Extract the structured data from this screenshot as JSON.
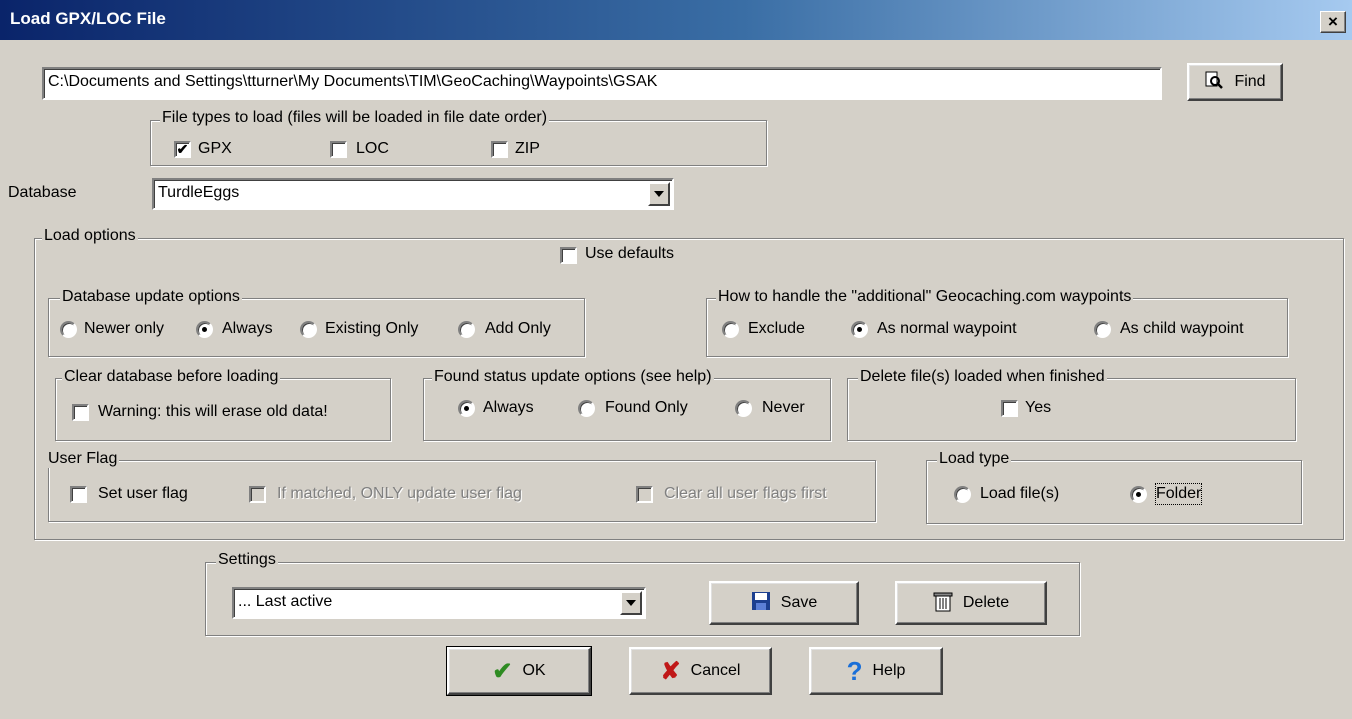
{
  "window": {
    "title": "Load GPX/LOC File",
    "close_glyph": "×"
  },
  "path_field": {
    "value": "C:\\Documents and Settings\\tturner\\My Documents\\TIM\\GeoCaching\\Waypoints\\GSAK"
  },
  "find_button": {
    "label": "Find",
    "icon": "find-document-icon"
  },
  "file_types": {
    "legend": "File types to load (files will be loaded in file date order)",
    "options": [
      {
        "label": "GPX",
        "checked": true
      },
      {
        "label": "LOC",
        "checked": false
      },
      {
        "label": "ZIP",
        "checked": false
      }
    ]
  },
  "database": {
    "label": "Database",
    "value": "TurdleEggs"
  },
  "load_options": {
    "legend": "Load options",
    "use_defaults": {
      "label": "Use defaults",
      "checked": false
    }
  },
  "db_update": {
    "legend": "Database update options",
    "options": [
      {
        "label": "Newer only",
        "selected": false
      },
      {
        "label": "Always",
        "selected": true
      },
      {
        "label": "Existing Only",
        "selected": false
      },
      {
        "label": "Add Only",
        "selected": false
      }
    ]
  },
  "additional": {
    "legend": "How to handle the \"additional\" Geocaching.com waypoints",
    "options": [
      {
        "label": "Exclude",
        "selected": false
      },
      {
        "label": "As normal waypoint",
        "selected": true
      },
      {
        "label": "As child waypoint",
        "selected": false
      }
    ]
  },
  "clear_db": {
    "legend": "Clear database before loading",
    "checkbox_label": "Warning: this will erase old data!",
    "checked": false
  },
  "found_status": {
    "legend": "Found status update options (see help)",
    "options": [
      {
        "label": "Always",
        "selected": true
      },
      {
        "label": "Found Only",
        "selected": false
      },
      {
        "label": "Never",
        "selected": false
      }
    ]
  },
  "delete_files": {
    "legend": "Delete file(s) loaded when finished",
    "checkbox_label": "Yes",
    "checked": false
  },
  "user_flag": {
    "legend": "User Flag",
    "set": "Set user flag",
    "matched_only": "If matched, ONLY update user flag",
    "clear_all": "Clear all user flags first"
  },
  "load_type": {
    "legend": "Load type",
    "options": [
      {
        "label": "Load file(s)",
        "selected": false
      },
      {
        "label": "Folder",
        "selected": true
      }
    ]
  },
  "settings": {
    "legend": "Settings",
    "value": "... Last active",
    "save_label": "Save",
    "delete_label": "Delete"
  },
  "buttons": {
    "ok": "OK",
    "cancel": "Cancel",
    "help": "Help"
  },
  "colors": {
    "face": "#d4d0c8",
    "title_start": "#0a246a",
    "title_end": "#a6caf0",
    "ok_check": "#2e8b22",
    "cancel_x": "#c01818",
    "help_q": "#1a6fd8",
    "save_disk": "#1c3f8f"
  }
}
